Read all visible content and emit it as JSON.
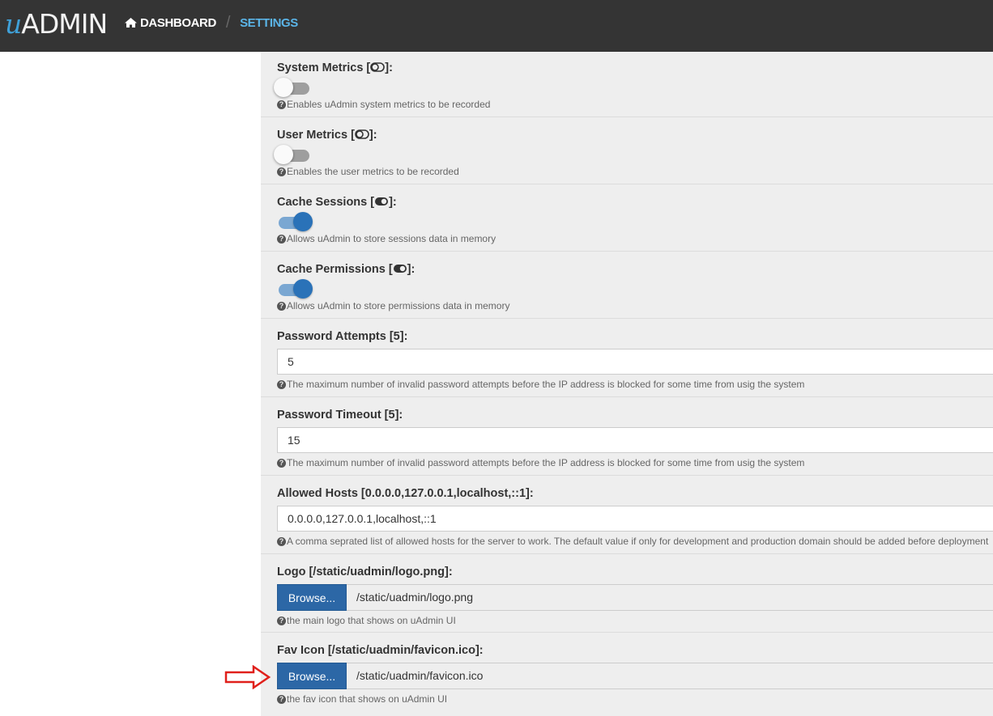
{
  "nav": {
    "logo_prefix": "u",
    "logo_rest": "ADMIN",
    "dashboard": "DASHBOARD",
    "separator": "/",
    "settings": "SETTINGS"
  },
  "settings": [
    {
      "label": "System Metrics [",
      "label_end": "]:",
      "type": "toggle",
      "on": false,
      "help": "Enables uAdmin system metrics to be recorded"
    },
    {
      "label": "User Metrics [",
      "label_end": "]:",
      "type": "toggle",
      "on": false,
      "help": "Enables the user metrics to be recorded"
    },
    {
      "label": "Cache Sessions [",
      "label_end": "]:",
      "type": "toggle",
      "on": true,
      "help": "Allows uAdmin to store sessions data in memory"
    },
    {
      "label": "Cache Permissions [",
      "label_end": "]:",
      "type": "toggle",
      "on": true,
      "help": "Allows uAdmin to store permissions data in memory"
    },
    {
      "label": "Password Attempts [5]:",
      "type": "text",
      "value": "5",
      "help": "The maximum number of invalid password attempts before the IP address is blocked for some time from usig the system"
    },
    {
      "label": "Password Timeout [5]:",
      "type": "text",
      "value": "15",
      "help": "The maximum number of invalid password attempts before the IP address is blocked for some time from usig the system"
    },
    {
      "label": "Allowed Hosts [0.0.0.0,127.0.0.1,localhost,::1]:",
      "type": "text",
      "value": "0.0.0.0,127.0.0.1,localhost,::1",
      "help": "A comma seprated list of allowed hosts for the server to work. The default value if only for development and production domain should be added before deployment"
    },
    {
      "label": "Logo [/static/uadmin/logo.png]:",
      "type": "file",
      "button": "Browse...",
      "value": "/static/uadmin/logo.png",
      "help": "the main logo that shows on uAdmin UI"
    },
    {
      "label": "Fav Icon [/static/uadmin/favicon.ico]:",
      "type": "file",
      "button": "Browse...",
      "value": "/static/uadmin/favicon.ico",
      "help": "the fav icon that shows on uAdmin UI"
    }
  ],
  "help_icon": "?",
  "colors": {
    "navbar": "#343434",
    "accent": "#5bb5e8",
    "toggle_on": "#2a72b8",
    "button": "#2c67a6",
    "annotation_arrow": "#e0201b"
  },
  "icons": {
    "home": "home-icon",
    "help": "question-circle-icon",
    "toggle_off_glyph": "toggle-off-icon",
    "toggle_on_glyph": "toggle-on-icon",
    "annotation": "red-arrow-icon"
  }
}
